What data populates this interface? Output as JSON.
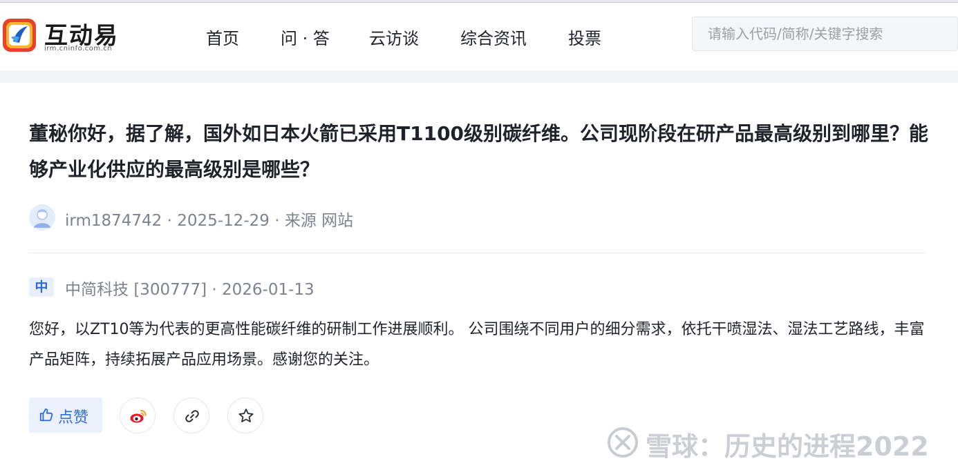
{
  "brand": {
    "name": "互动易",
    "domain": "irm.cninfo.com.cn"
  },
  "nav": {
    "items": [
      "首页",
      "问 · 答",
      "云访谈",
      "综合资讯",
      "投票"
    ]
  },
  "search": {
    "placeholder": "请输入代码/简称/关键字搜索"
  },
  "question": {
    "text": "董秘你好，据了解，国外如日本火箭已采用T1100级别碳纤维。公司现阶段在研产品最高级别到哪里？能够产业化供应的最高级别是哪些？",
    "asker": "irm1874742",
    "date": "2025-12-29",
    "source_label": "来源",
    "source": "网站",
    "separator": " · "
  },
  "answer": {
    "badge": "中",
    "company": "中简科技",
    "code": "[300777]",
    "date": "2026-01-13",
    "text": "您好，以ZT10等为代表的更高性能碳纤维的研制工作进展顺利。 公司围绕不同用户的细分需求，依托干喷湿法、湿法工艺路线，丰富产品矩阵，持续拓展产品应用场景。感谢您的关注。"
  },
  "actions": {
    "like_label": "点赞",
    "icons": [
      "thumbs-up-icon",
      "weibo-icon",
      "link-icon",
      "star-icon"
    ]
  },
  "watermark": {
    "text": "雪球：历史的进程2022"
  },
  "colors": {
    "accent": "#2f6bdb",
    "badge_bg": "#e8f0fe",
    "meta_text": "#7d838c",
    "weibo_red": "#e6162d"
  }
}
